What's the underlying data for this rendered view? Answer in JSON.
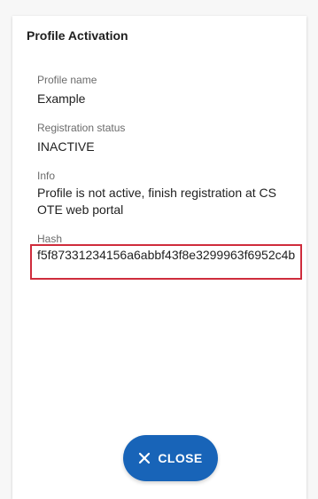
{
  "dialog": {
    "title": "Profile Activation",
    "fields": {
      "profile_name": {
        "label": "Profile name",
        "value": "Example"
      },
      "registration_status": {
        "label": "Registration status",
        "value": "INACTIVE"
      },
      "info": {
        "label": "Info",
        "value": "Profile is not active, finish registration at CS OTE web portal"
      },
      "hash": {
        "label": "Hash",
        "value": "f5f87331234156a6abbf43f8e3299963f6952c4b"
      }
    },
    "close_button": {
      "label": "CLOSE",
      "icon": "close-icon"
    }
  },
  "colors": {
    "accent": "#1864b8",
    "highlight_border": "#cf2c3c"
  }
}
